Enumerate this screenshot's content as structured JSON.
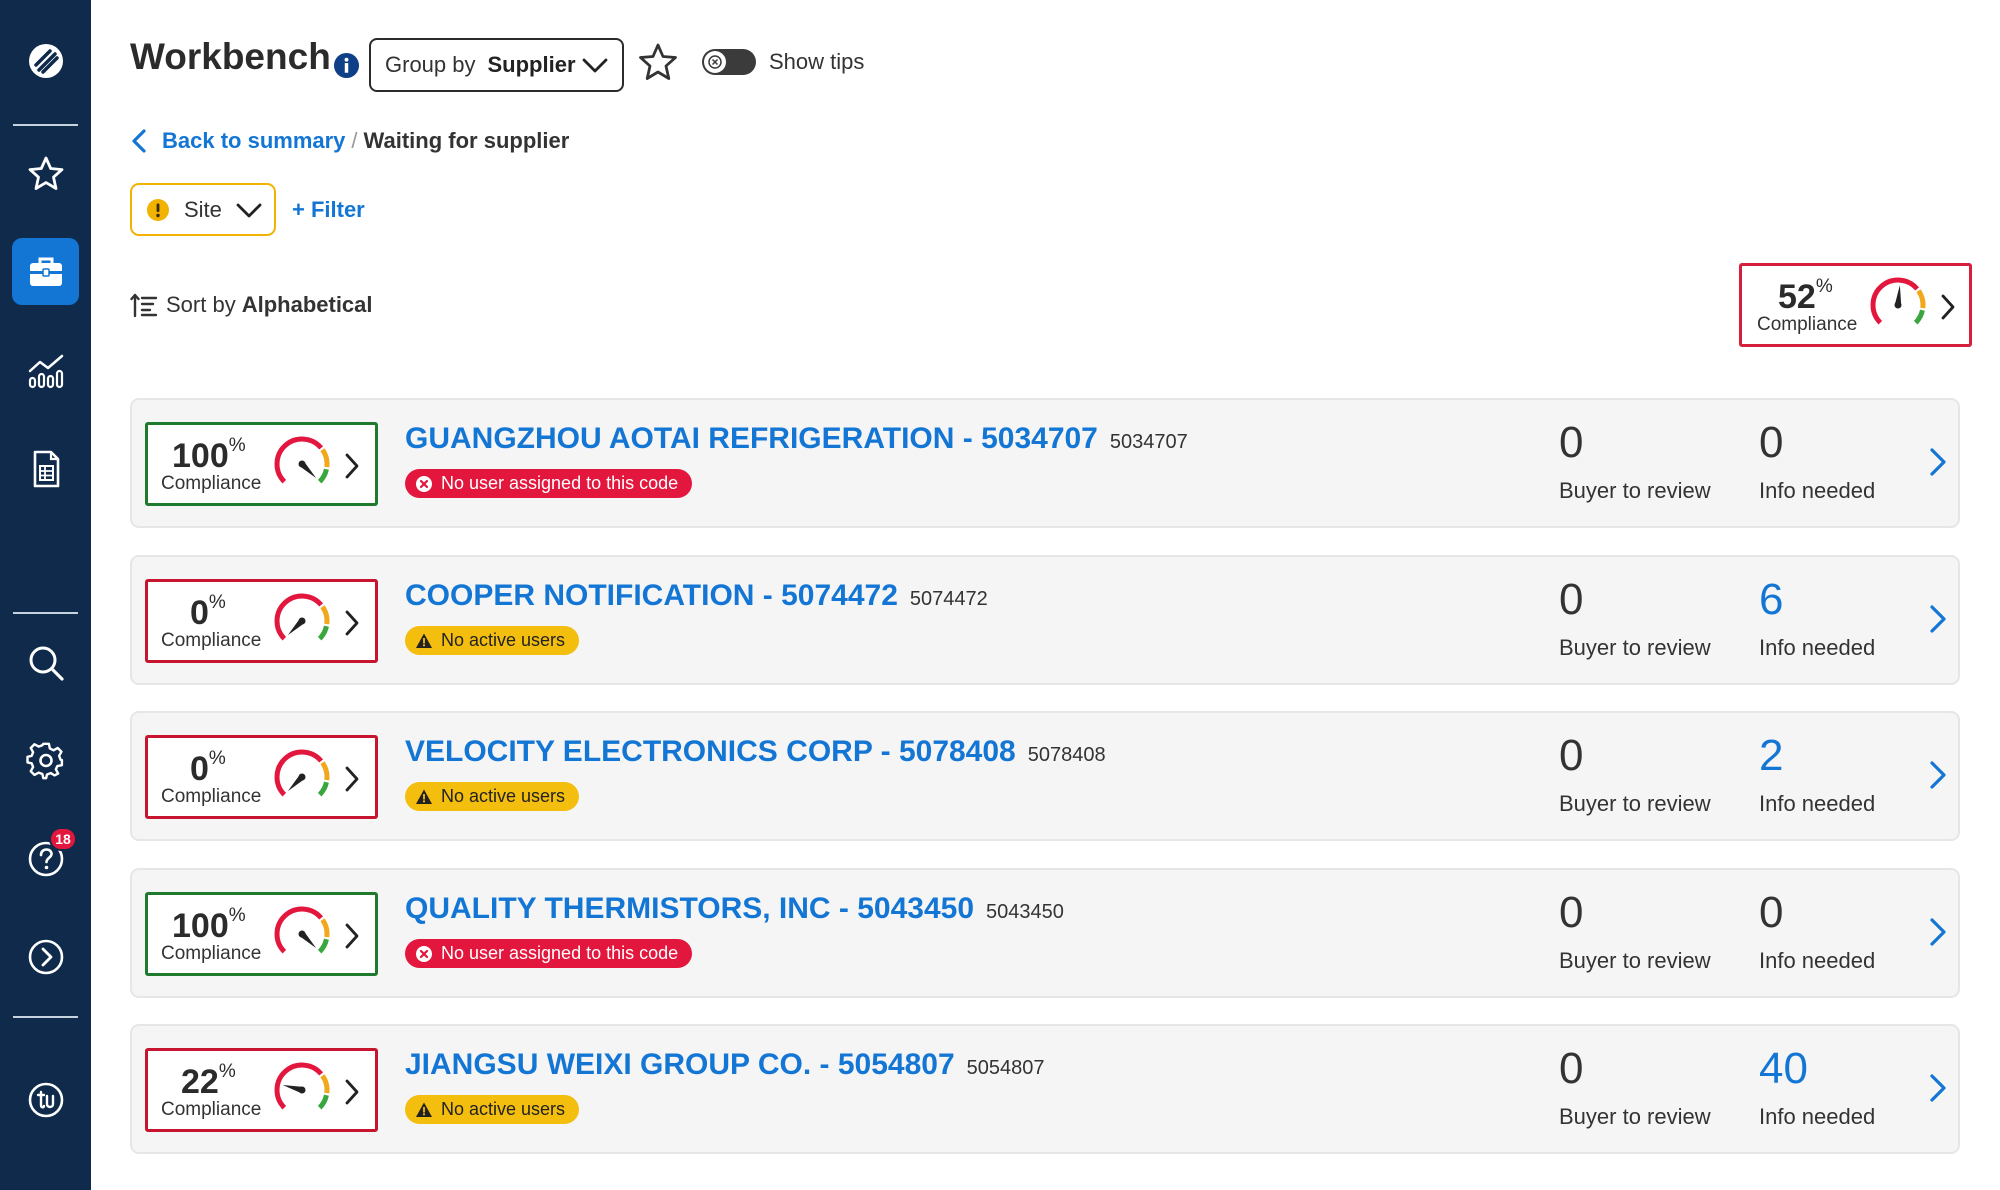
{
  "header": {
    "title": "Workbench",
    "group_by_label": "Group by",
    "group_by_value": "Supplier",
    "show_tips_label": "Show tips"
  },
  "breadcrumb": {
    "back_label": "Back to summary",
    "separator": "/",
    "current": "Waiting for supplier"
  },
  "filters": {
    "site_label": "Site",
    "add_filter_label": "+ Filter"
  },
  "sort": {
    "label": "Sort by",
    "value": "Alphabetical"
  },
  "overall": {
    "percent": "52",
    "percent_sign": "%",
    "label": "Compliance"
  },
  "sidebar": {
    "help_badge": "18",
    "icons": [
      "logo-icon",
      "star-icon",
      "briefcase-icon",
      "chart-icon",
      "report-icon",
      "search-icon",
      "gear-icon",
      "help-icon",
      "expand-icon",
      "account-icon"
    ]
  },
  "suppliers": [
    {
      "compliance": "100",
      "percent_sign": "%",
      "compliance_label": "Compliance",
      "status": "good",
      "name": "GUANGZHOU AOTAI REFRIGERATION - 5034707",
      "code": "5034707",
      "pill": "No user assigned to this code",
      "pill_type": "red",
      "buyer_count": "0",
      "buyer_label": "Buyer to review",
      "info_count": "0",
      "info_label": "Info needed",
      "info_highlight": false
    },
    {
      "compliance": "0",
      "percent_sign": "%",
      "compliance_label": "Compliance",
      "status": "bad",
      "name": "COOPER NOTIFICATION - 5074472",
      "code": "5074472",
      "pill": "No active users",
      "pill_type": "yellow",
      "buyer_count": "0",
      "buyer_label": "Buyer to review",
      "info_count": "6",
      "info_label": "Info needed",
      "info_highlight": true
    },
    {
      "compliance": "0",
      "percent_sign": "%",
      "compliance_label": "Compliance",
      "status": "bad",
      "name": "VELOCITY ELECTRONICS CORP - 5078408",
      "code": "5078408",
      "pill": "No active users",
      "pill_type": "yellow",
      "buyer_count": "0",
      "buyer_label": "Buyer to review",
      "info_count": "2",
      "info_label": "Info needed",
      "info_highlight": true
    },
    {
      "compliance": "100",
      "percent_sign": "%",
      "compliance_label": "Compliance",
      "status": "good",
      "name": "QUALITY THERMISTORS, INC - 5043450",
      "code": "5043450",
      "pill": "No user assigned to this code",
      "pill_type": "red",
      "buyer_count": "0",
      "buyer_label": "Buyer to review",
      "info_count": "0",
      "info_label": "Info needed",
      "info_highlight": false
    },
    {
      "compliance": "22",
      "percent_sign": "%",
      "compliance_label": "Compliance",
      "status": "bad",
      "name": "JIANGSU WEIXI GROUP CO. - 5054807",
      "code": "5054807",
      "pill": "No active users",
      "pill_type": "yellow",
      "buyer_count": "0",
      "buyer_label": "Buyer to review",
      "info_count": "40",
      "info_label": "Info needed",
      "info_highlight": true
    }
  ],
  "colors": {
    "sidebar_bg": "#0f2a4b",
    "accent_blue": "#1476d4",
    "good_green": "#1f7a2e",
    "bad_red": "#c7152f",
    "warning_yellow": "#f4be0f"
  }
}
